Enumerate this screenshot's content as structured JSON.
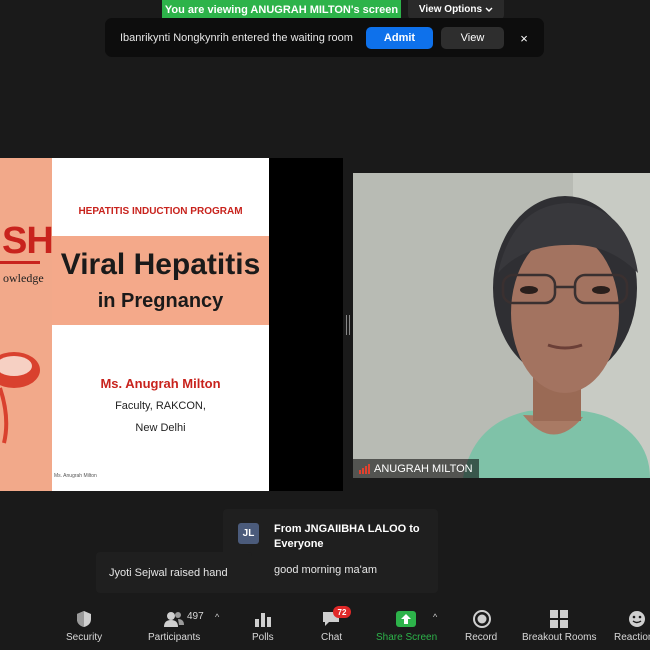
{
  "banner": {
    "viewing_text": "You are viewing ANUGRAH MILTON's screen",
    "view_options_label": "View Options"
  },
  "waiting_room": {
    "message": "Ibanrikynti Nongkynrih entered the waiting room",
    "admit_label": "Admit",
    "view_label": "View",
    "close_glyph": "×"
  },
  "slide": {
    "brand_letters": "SH",
    "brand_tagline": "owledge",
    "program": "HEPATITIS INDUCTION PROGRAM",
    "title_line1": "Viral Hepatitis",
    "title_line2": "in Pregnancy",
    "presenter": "Ms. Anugrah Milton",
    "affiliation_line1": "Faculty, RAKCON,",
    "affiliation_line2": "New Delhi",
    "footer": "Ms. Anugrah Milton"
  },
  "video": {
    "participant_name": "ANUGRAH MILTON"
  },
  "chat": {
    "avatar_initials": "JL",
    "from": "From JNGAIIBHA LALOO to Everyone",
    "message": "good morning ma'am"
  },
  "notification": {
    "raised_hand": "Jyoti Sejwal raised hand"
  },
  "toolbar": {
    "security_label": "Security",
    "participants_label": "Participants",
    "participants_count": "497",
    "polls_label": "Polls",
    "chat_label": "Chat",
    "chat_badge": "72",
    "share_label": "Share Screen",
    "record_label": "Record",
    "breakout_label": "Breakout Rooms",
    "reactions_label": "Reactions"
  },
  "colors": {
    "share_green": "#2db34a",
    "admit_blue": "#0e71eb",
    "badge_red": "#e02828",
    "slide_red": "#c8231d",
    "slide_peach": "#f4a98a"
  }
}
